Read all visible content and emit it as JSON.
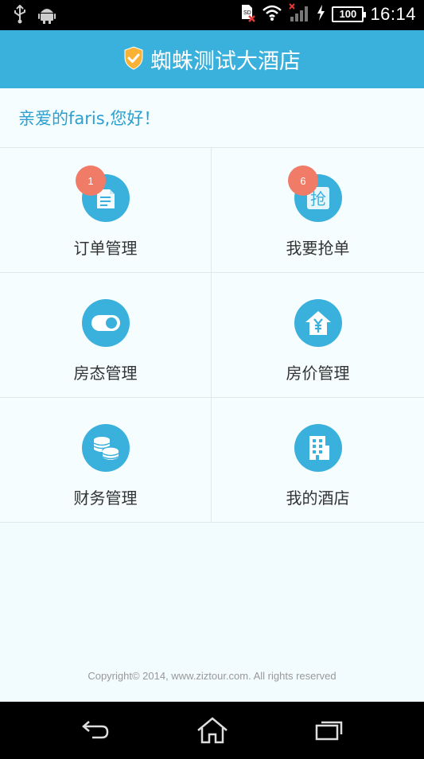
{
  "status_bar": {
    "time": "16:14",
    "battery": "100",
    "icons": [
      "usb-icon",
      "android-icon",
      "sd-card-error-icon",
      "wifi-icon",
      "signal-icon",
      "charging-icon"
    ]
  },
  "header": {
    "title": "蜘蛛测试大酒店",
    "icon": "shield-check-icon"
  },
  "greeting": "亲爱的faris,您好！",
  "menu": [
    {
      "label": "订单管理",
      "icon": "order-document-icon",
      "badge": "1"
    },
    {
      "label": "我要抢单",
      "icon": "grab-order-icon",
      "badge": "6",
      "icon_text": "抢"
    },
    {
      "label": "房态管理",
      "icon": "toggle-icon"
    },
    {
      "label": "房价管理",
      "icon": "house-price-icon"
    },
    {
      "label": "财务管理",
      "icon": "coins-icon"
    },
    {
      "label": "我的酒店",
      "icon": "building-icon"
    }
  ],
  "footer": {
    "copyright": "Copyright© 2014, www.ziztour.com. All rights reserved"
  },
  "navbar": [
    "back-icon",
    "home-icon",
    "recent-apps-icon"
  ],
  "colors": {
    "accent": "#3ab0dc",
    "badge": "#f07c68",
    "greeting_text": "#2b9fcf",
    "background": "#f2fbfd"
  }
}
